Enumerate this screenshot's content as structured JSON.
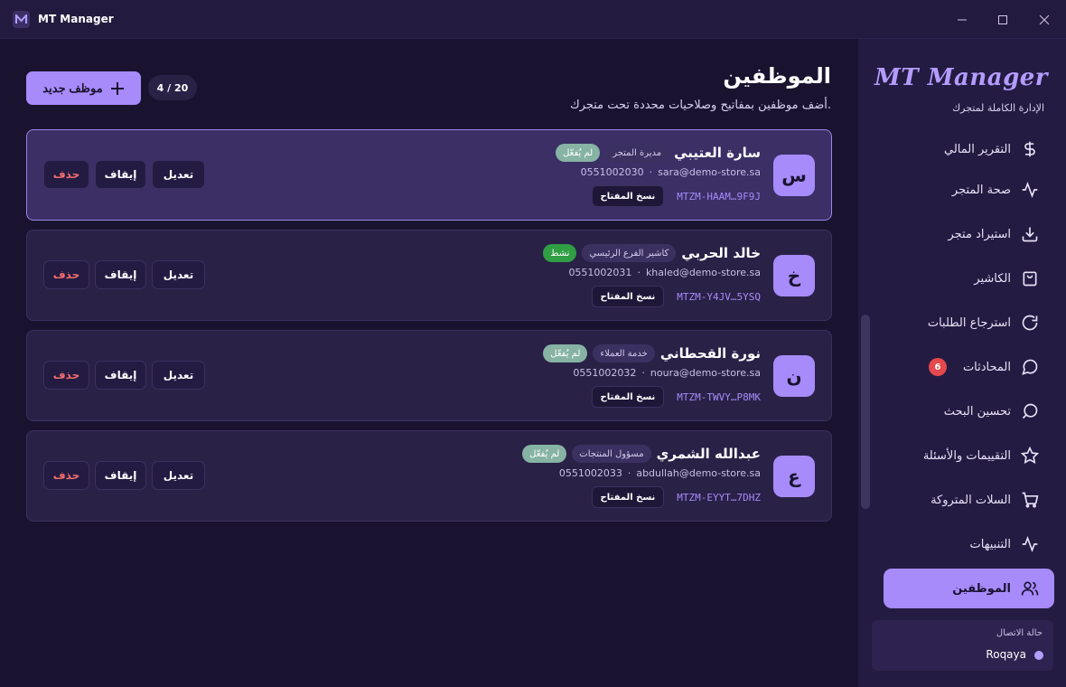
{
  "window": {
    "title": "MT Manager",
    "logo_letter": "M"
  },
  "sidebar": {
    "brand": "MT Manager",
    "brand_sub": "الإدارة الكاملة لمتجرك",
    "items": [
      {
        "label": "التقرير المالي",
        "icon": "dollar-icon"
      },
      {
        "label": "صحة المتجر",
        "icon": "pulse-icon"
      },
      {
        "label": "استيراد متجر",
        "icon": "download-icon"
      },
      {
        "label": "الكاشير",
        "icon": "bag-icon"
      },
      {
        "label": "استرجاع الطلبات",
        "icon": "refresh-icon"
      },
      {
        "label": "المحادثات",
        "icon": "chat-icon",
        "badge": "6"
      },
      {
        "label": "تحسين البحث",
        "icon": "search-icon"
      },
      {
        "label": "التقييمات والأسئلة",
        "icon": "star-icon"
      },
      {
        "label": "السلات المتروكة",
        "icon": "cart-icon"
      },
      {
        "label": "التنبيهات",
        "icon": "pulse-icon"
      },
      {
        "label": "الموظفين",
        "icon": "users-icon",
        "active": true
      }
    ],
    "connection": {
      "label": "حالة الاتصال",
      "user": "Roqaya"
    }
  },
  "main": {
    "title": "الموظفين",
    "subtitle": "أضف موظفين بمفاتيح وصلاحيات محددة تحت متجرك.",
    "add_button": "موظف جديد",
    "count": "4 / 20",
    "actions": {
      "edit": "تعديل",
      "suspend": "إيقاف",
      "delete": "حذف",
      "copy_key": "نسخ المفتاح"
    },
    "employees": [
      {
        "initial": "س",
        "name": "سارة العتيبي",
        "role": "مديرة المتجر",
        "status": "لم يُفعّل",
        "email": "sara@demo-store.sa",
        "phone": "0551002030",
        "key": "MTZM-HAAM…9F9J"
      },
      {
        "initial": "خ",
        "name": "خالد الحربي",
        "role": "كاشير الفرع الرئيسي",
        "status": "نشط",
        "email": "khaled@demo-store.sa",
        "phone": "0551002031",
        "key": "MTZM-Y4JV…5YSQ"
      },
      {
        "initial": "ن",
        "name": "نورة القحطاني",
        "role": "خدمة العملاء",
        "status": "لم يُفعّل",
        "email": "noura@demo-store.sa",
        "phone": "0551002032",
        "key": "MTZM-TWVY…P8MK"
      },
      {
        "initial": "ع",
        "name": "عبدالله الشمري",
        "role": "مسؤول المنتجات",
        "status": "لم يُفعّل",
        "email": "abdullah@demo-store.sa",
        "phone": "0551002033",
        "key": "MTZM-EYYT…7DHZ"
      }
    ]
  },
  "colors": {
    "accent": "#a78bfa",
    "status_active": "#2f9e44",
    "status_inactive": "#86b3a3",
    "danger": "#f26d6d"
  }
}
